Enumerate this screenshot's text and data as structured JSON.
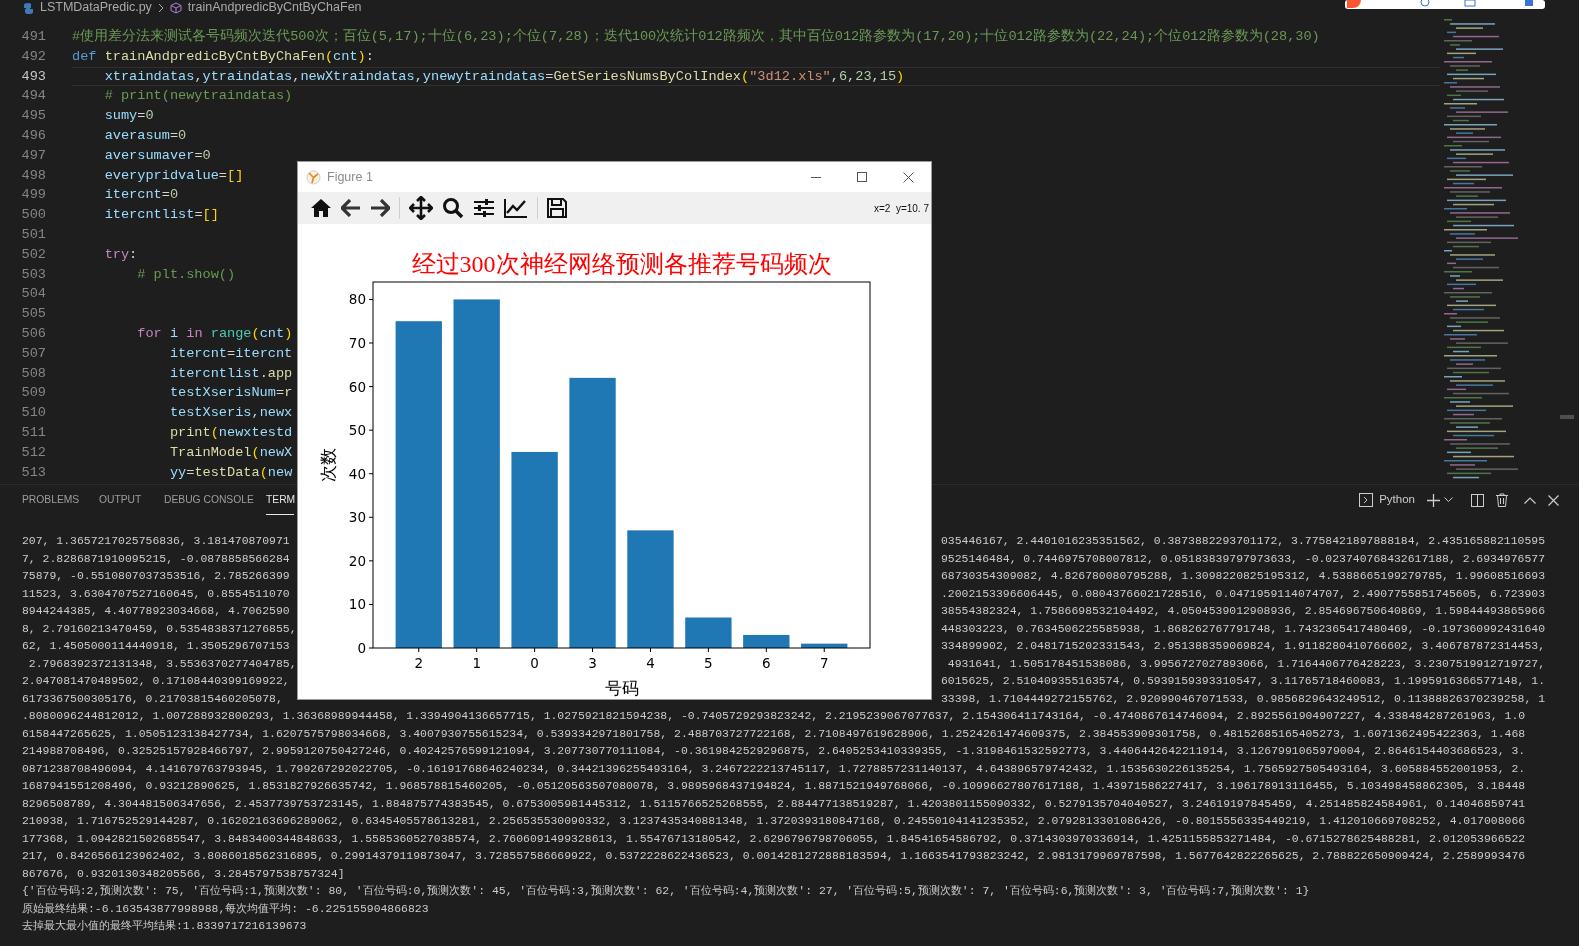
{
  "breadcrumb": [
    "LSTMDataPredic.py",
    "trainAndpredicByCntByChaFen"
  ],
  "editor": {
    "lines": [
      {
        "number": "491",
        "current": false,
        "tokens": [
          {
            "kind": "comment",
            "text": "#使用差分法来测试各号码频次迭代500次；百位(5,17);十位(6,23);个位(7,28)；迭代100次统计012路频次，其中百位012路参数为(17,20);十位012路参数为(22,24);个位012路参数为(28,30)"
          }
        ]
      },
      {
        "number": "492",
        "current": false,
        "tokens": [
          {
            "kind": "kw",
            "text": "def "
          },
          {
            "kind": "func",
            "text": "trainAndpredicByCntByChaFen"
          },
          {
            "kind": "bracket",
            "text": "("
          },
          {
            "kind": "var",
            "text": "cnt"
          },
          {
            "kind": "bracket",
            "text": ")"
          },
          {
            "kind": "p",
            "text": ":"
          }
        ]
      },
      {
        "number": "493",
        "current": true,
        "tokens": [
          {
            "kind": "var",
            "text": "    xtraindatas"
          },
          {
            "kind": "p",
            "text": ","
          },
          {
            "kind": "var",
            "text": "ytraindatas"
          },
          {
            "kind": "p",
            "text": ","
          },
          {
            "kind": "var",
            "text": "newXtraindatas"
          },
          {
            "kind": "p",
            "text": ","
          },
          {
            "kind": "var",
            "text": "ynewytraindatas"
          },
          {
            "kind": "p",
            "text": "="
          },
          {
            "kind": "func",
            "text": "GetSeriesNumsByColIndex"
          },
          {
            "kind": "bracket",
            "text": "("
          },
          {
            "kind": "str",
            "text": "\"3d12.xls\""
          },
          {
            "kind": "p",
            "text": ","
          },
          {
            "kind": "num",
            "text": "6"
          },
          {
            "kind": "p",
            "text": ","
          },
          {
            "kind": "num",
            "text": "23"
          },
          {
            "kind": "p",
            "text": ","
          },
          {
            "kind": "num",
            "text": "15"
          },
          {
            "kind": "bracket",
            "text": ")"
          }
        ]
      },
      {
        "number": "494",
        "current": false,
        "tokens": [
          {
            "kind": "comment",
            "text": "    # print(newytraindatas)"
          }
        ]
      },
      {
        "number": "495",
        "current": false,
        "tokens": [
          {
            "kind": "var",
            "text": "    sumy"
          },
          {
            "kind": "p",
            "text": "="
          },
          {
            "kind": "num",
            "text": "0"
          }
        ]
      },
      {
        "number": "496",
        "current": false,
        "tokens": [
          {
            "kind": "var",
            "text": "    averasum"
          },
          {
            "kind": "p",
            "text": "="
          },
          {
            "kind": "num",
            "text": "0"
          }
        ]
      },
      {
        "number": "497",
        "current": false,
        "tokens": [
          {
            "kind": "var",
            "text": "    aversumaver"
          },
          {
            "kind": "p",
            "text": "="
          },
          {
            "kind": "num",
            "text": "0"
          }
        ]
      },
      {
        "number": "498",
        "current": false,
        "tokens": [
          {
            "kind": "var",
            "text": "    everypridvalue"
          },
          {
            "kind": "p",
            "text": "="
          },
          {
            "kind": "bracket",
            "text": "[]"
          }
        ]
      },
      {
        "number": "499",
        "current": false,
        "tokens": [
          {
            "kind": "var",
            "text": "    itercnt"
          },
          {
            "kind": "p",
            "text": "="
          },
          {
            "kind": "num",
            "text": "0"
          }
        ]
      },
      {
        "number": "500",
        "current": false,
        "tokens": [
          {
            "kind": "var",
            "text": "    itercntlist"
          },
          {
            "kind": "p",
            "text": "="
          },
          {
            "kind": "bracket",
            "text": "[]"
          }
        ]
      },
      {
        "number": "501",
        "current": false
      },
      {
        "number": "502",
        "current": false,
        "tokens": [
          {
            "kind": "kw2",
            "text": "    try"
          },
          {
            "kind": "p",
            "text": ":"
          }
        ]
      },
      {
        "number": "503",
        "current": false,
        "tokens": [
          {
            "kind": "comment",
            "text": "        # plt.show()"
          }
        ]
      },
      {
        "number": "504",
        "current": false
      },
      {
        "number": "505",
        "current": false
      },
      {
        "number": "506",
        "current": false,
        "tokens": [
          {
            "kind": "kw2",
            "text": "        for "
          },
          {
            "kind": "var",
            "text": "i "
          },
          {
            "kind": "kw2",
            "text": "in "
          },
          {
            "kind": "class",
            "text": "range"
          },
          {
            "kind": "bracket",
            "text": "("
          },
          {
            "kind": "var",
            "text": "cnt"
          },
          {
            "kind": "bracket",
            "text": ")"
          }
        ]
      },
      {
        "number": "507",
        "current": false,
        "tokens": [
          {
            "kind": "var",
            "text": "            itercnt"
          },
          {
            "kind": "p",
            "text": "="
          },
          {
            "kind": "var",
            "text": "itercnt"
          }
        ]
      },
      {
        "number": "508",
        "current": false,
        "tokens": [
          {
            "kind": "var",
            "text": "            itercntlist"
          },
          {
            "kind": "p",
            "text": "."
          },
          {
            "kind": "func",
            "text": "app"
          }
        ]
      },
      {
        "number": "509",
        "current": false,
        "tokens": [
          {
            "kind": "var",
            "text": "            testXserisNum"
          },
          {
            "kind": "p",
            "text": "="
          },
          {
            "kind": "func",
            "text": "r"
          }
        ]
      },
      {
        "number": "510",
        "current": false,
        "tokens": [
          {
            "kind": "var",
            "text": "            testXseris"
          },
          {
            "kind": "p",
            "text": ","
          },
          {
            "kind": "var",
            "text": "newx"
          }
        ]
      },
      {
        "number": "511",
        "current": false,
        "tokens": [
          {
            "kind": "func",
            "text": "            print"
          },
          {
            "kind": "bracket",
            "text": "("
          },
          {
            "kind": "var",
            "text": "newxtestd"
          }
        ]
      },
      {
        "number": "512",
        "current": false,
        "tokens": [
          {
            "kind": "func",
            "text": "            TrainModel"
          },
          {
            "kind": "bracket",
            "text": "("
          },
          {
            "kind": "var",
            "text": "newX"
          }
        ]
      },
      {
        "number": "513",
        "current": false,
        "tokens": [
          {
            "kind": "var",
            "text": "            yy"
          },
          {
            "kind": "p",
            "text": "="
          },
          {
            "kind": "func",
            "text": "testData"
          },
          {
            "kind": "bracket",
            "text": "("
          },
          {
            "kind": "var",
            "text": "new"
          }
        ]
      }
    ]
  },
  "panel": {
    "tabs": [
      {
        "label": "PROBLEMS",
        "selected": false
      },
      {
        "label": "OUTPUT",
        "selected": false
      },
      {
        "label": "DEBUG CONSOLE",
        "selected": false
      },
      {
        "label": "TERM",
        "selected": true
      }
    ],
    "terminal_name": "Python",
    "terminal": [
      {
        "kind": "split",
        "left": "207, 1.3657217025756836, 3.181470870971",
        "right": "035446167, 2.4401016235351562, 0.3873882293701172, 3.7758421897888184, 2.435165882110595"
      },
      {
        "kind": "split",
        "left": "7, 2.8286871910095215, -0.0878858566284",
        "right": "9525146484, 0.7446975708007812, 0.05183839797973633, -0.023740768432617188, 2.6934976577"
      },
      {
        "kind": "split",
        "left": "75879, -0.5510807037353516, 2.785266399",
        "right": "68730354309082, 4.826780080795288, 1.3098220825195312, 4.5388665199279785, 1.99608516693"
      },
      {
        "kind": "split",
        "left": "11523, 3.6304707527160645, 0.8554511070",
        "right": ".2002153396606445, 0.08043766021728516, 0.0471959114074707, 2.4907755851745605, 6.723903"
      },
      {
        "kind": "split",
        "left": "8944244385, 4.40778923034668, 4.7062590",
        "right": "38554382324, 1.7586698532104492, 4.0504539012908936, 2.854696750640869, 1.59844493865966"
      },
      {
        "kind": "split",
        "left": "8, 2.79160213470459, 0.5354838371276855,",
        "right": "448303223, 0.7634506225585938, 1.868262767791748, 1.7432365417480469, -0.197360992431640"
      },
      {
        "kind": "split",
        "left": "62, 1.4505000114440918, 1.3505296707153",
        "right": "334899902, 2.0481715202331543, 2.951388359069824, 1.9118280410766602, 3.406787872314453,"
      },
      {
        "kind": "split",
        "left": " 2.7968392372131348, 3.5536370277404785,",
        "right": "4931641, 1.505178451538086, 3.9956727027893066, 1.7164406776428223, 3.2307519912719727,"
      },
      {
        "kind": "split",
        "left": "2.047081470489502, 0.17108440399169922,",
        "right": "6015625, 2.510409355163574, 0.5939159393310547, 3.11765718460083, 1.1995916366577148, 1."
      },
      {
        "kind": "split",
        "left": "6173367500305176, 0.21703815460205078,",
        "right": "33398, 1.7104449272155762, 2.920990467071533, 0.9856829643249512, 0.11388826370239258, 1"
      },
      {
        "kind": "full",
        "text": ".8080096244812012, 1.007288932800293, 1.36368989944458, 1.3394904136657715, 1.0275921821594238, -0.7405729293823242, 2.2195239067077637, 2.154306411743164, -0.4740867614746094, 2.8925561904907227, 4.338484287261963, 1.0"
      },
      {
        "kind": "full",
        "text": "6158447265625, 1.0505123138427734, 1.6207575798034668, 3.4007930755615234, 0.5393342971801758, 2.488703727722168, 2.7108497619628906, 1.2524261474609375, 2.384553909301758, 0.48152685165405273, 1.6071362495422363, 1.468"
      },
      {
        "kind": "full",
        "text": "214988708496, 0.32525157928466797, 2.9959120750427246, 0.40242576599121094, 3.207730770111084, -0.3619842529296875, 2.6405253410339355, -1.3198461532592773, 3.4406442642211914, 3.1267991065979004, 2.8646154403686523, 3."
      },
      {
        "kind": "full",
        "text": "0871238708496094, 4.141679763793945, 1.799267292022705, -0.16191768646240234, 0.34421396255493164, 3.2467222213745117, 1.7278857231140137, 4.643896579742432, 1.1535630226135254, 1.7565927505493164, 3.605884552001953, 2."
      },
      {
        "kind": "full",
        "text": "1687941551208496, 0.93212890625, 1.8531827926635742, 1.968578815460205, -0.05120563507080078, 3.9895968437194824, 1.8871521949768066, -0.10996627807617188, 1.43971586227417, 3.196178913116455, 5.103498458862305, 3.18448"
      },
      {
        "kind": "full",
        "text": "8296508789, 4.304481506347656, 2.4537739753723145, 1.884875774383545, 0.6753005981445312, 1.5115766525268555, 2.884477138519287, 1.4203801155090332, 0.5279135704040527, 3.24619197845459, 4.251485824584961, 0.14046859741"
      },
      {
        "kind": "full",
        "text": "210938, 1.716752529144287, 0.16202163696289062, 0.6345405578613281, 2.256535530090332, 3.1237435340881348, 1.3720393180847168, 0.24550104141235352, 2.0792813301086426, -0.8015556335449219, 1.412010669708252, 4.017008066"
      },
      {
        "kind": "full",
        "text": "177368, 1.0942821502685547, 3.8483400344848633, 1.5585360527038574, 2.7606091499328613, 1.55476713180542, 2.6296796798706055, 1.84541654586792, 0.3714303970336914, 1.4251155853271484, -0.6715278625488281, 2.012053966522"
      },
      {
        "kind": "full",
        "text": "217, 0.8426566123962402, 3.8086018562316895, 0.29914379119873047, 3.728557586669922, 0.5372228622436523, 0.0014281272888183594, 1.1663541793823242, 2.9813179969787598, 1.5677642822265625, 2.788822650909424, 2.2589993476"
      },
      {
        "kind": "full",
        "text": "867676, 0.9320130348205566, 3.2845797538757324]"
      },
      {
        "kind": "full",
        "text": "{'百位号码:2,预测次数': 75, '百位号码:1,预测次数': 80, '百位号码:0,预测次数': 45, '百位号码:3,预测次数': 62, '百位号码:4,预测次数': 27, '百位号码:5,预测次数': 7, '百位号码:6,预测次数': 3, '百位号码:7,预测次数': 1}"
      },
      {
        "kind": "full",
        "text": "原始最终结果:-6.163543877998988,每次均值平均: -6.225155904866823"
      },
      {
        "kind": "full",
        "text": "去掉最大最小值的最终平均结果:1.8339717216139673"
      }
    ]
  },
  "figure": {
    "title": "Figure 1",
    "coords": "x=2  y=10. 7",
    "chart_data": {
      "type": "bar",
      "title": "经过300次神经网络预测各推荐号码频次",
      "xlabel": "号码",
      "ylabel": "次数",
      "categories": [
        "2",
        "1",
        "0",
        "3",
        "4",
        "5",
        "6",
        "7"
      ],
      "series": [
        {
          "color": "#1f77b4",
          "values": [
            75,
            80,
            45,
            62,
            27,
            7,
            3,
            1
          ]
        }
      ],
      "ylim": [
        0,
        84
      ],
      "yticks": [
        0,
        10,
        20,
        30,
        40,
        50,
        60,
        70,
        80
      ]
    }
  }
}
